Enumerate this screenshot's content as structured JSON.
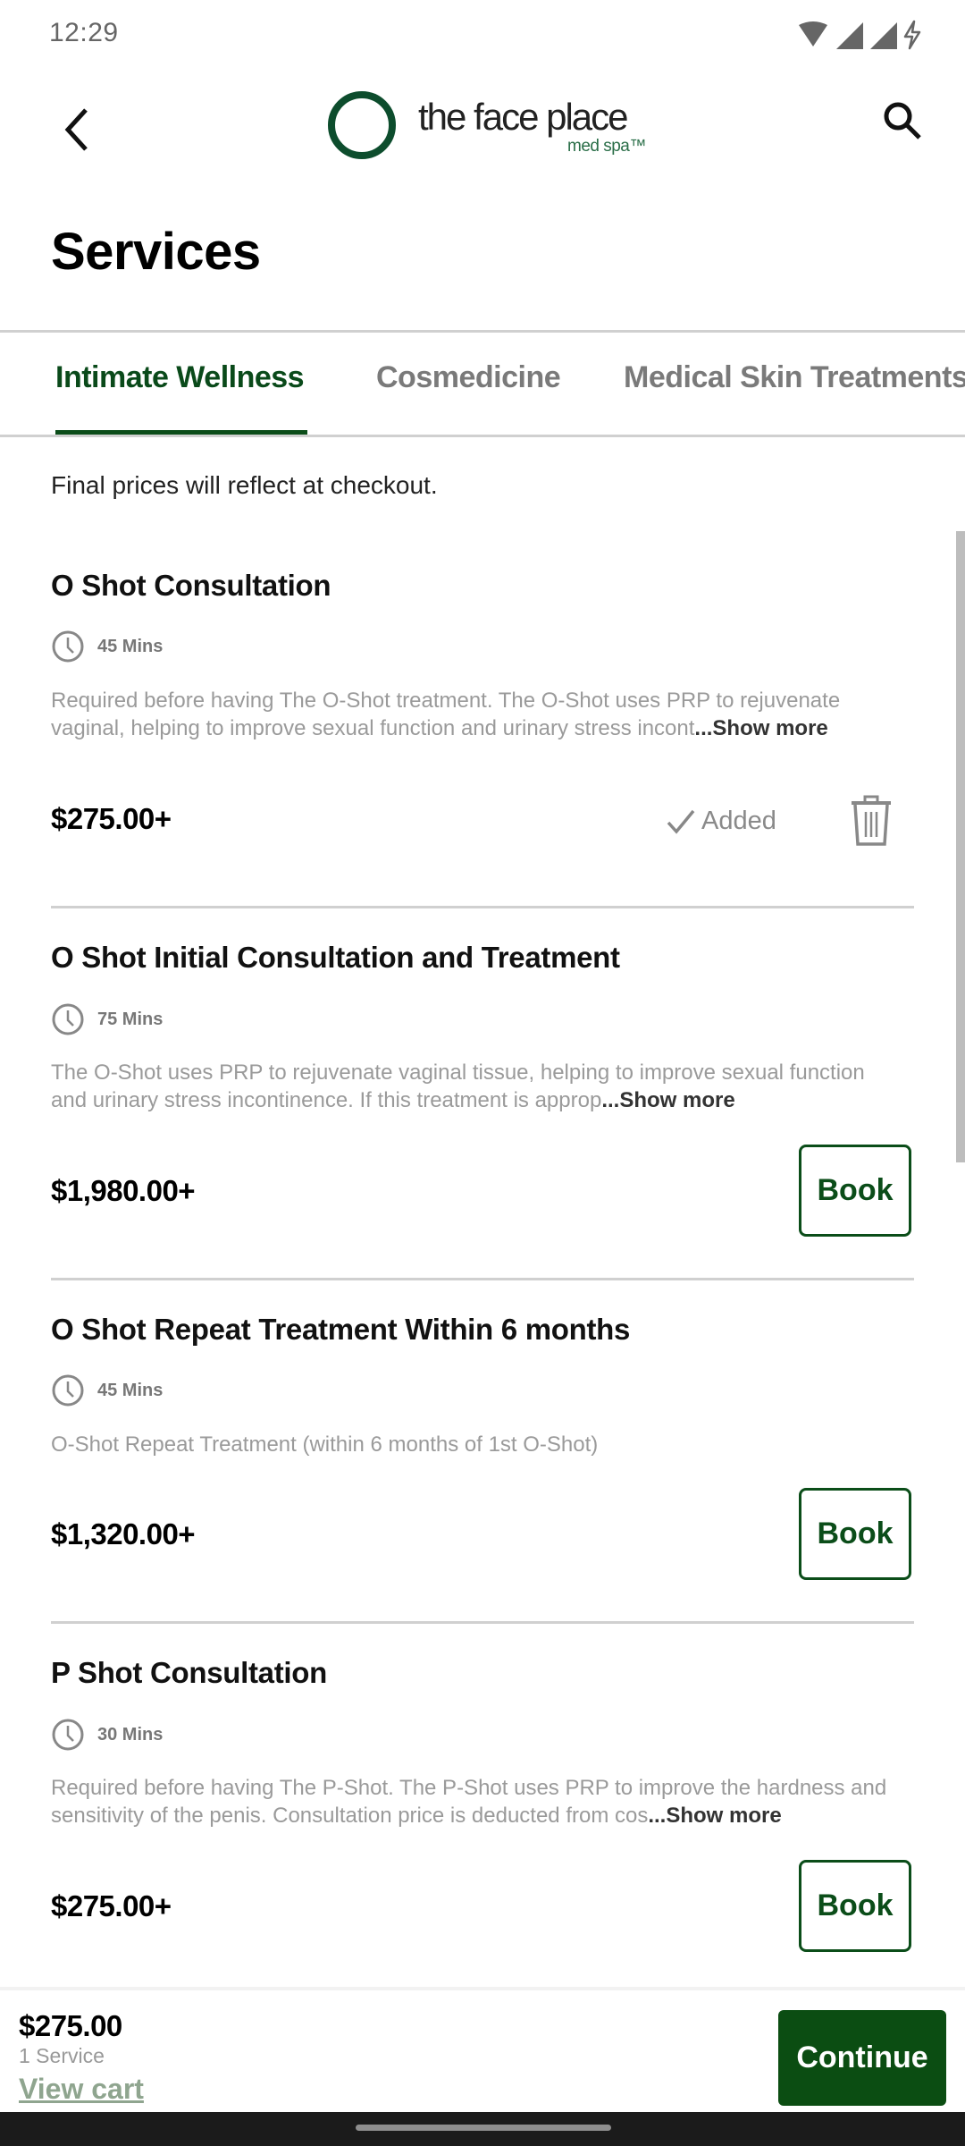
{
  "status_bar": {
    "time": "12:29",
    "icons": [
      "wifi-icon",
      "signal-icon",
      "signal-icon",
      "charging-icon"
    ]
  },
  "header": {
    "back_icon": "chevron-left-icon",
    "logo": {
      "name": "the face place",
      "tagline": "med spa™"
    },
    "search_icon": "search-icon"
  },
  "page_title": "Services",
  "tabs": [
    {
      "label": "Intimate Wellness",
      "active": true
    },
    {
      "label": "Cosmedicine",
      "active": false
    },
    {
      "label": "Medical Skin Treatments",
      "active": false
    }
  ],
  "notice": "Final prices will reflect at checkout.",
  "colors": {
    "brand_green": "#0b4d19",
    "muted_text": "#9a9a9a"
  },
  "services": [
    {
      "name": "O Shot Consultation",
      "duration": "45 Mins",
      "description": "Required before having The O-Shot treatment. The O-Shot uses PRP to rejuvenate vaginal, helping to improve sexual function and urinary stress incont",
      "show_more": "...Show more",
      "price": "$275.00+",
      "state": "added",
      "added_label": "Added"
    },
    {
      "name": "O Shot Initial Consultation and Treatment",
      "duration": "75 Mins",
      "description": "The O-Shot uses PRP to rejuvenate vaginal tissue, helping to improve sexual function and urinary stress incontinence. If this treatment is approp",
      "show_more": "...Show more",
      "price": "$1,980.00+",
      "book_label": "Book"
    },
    {
      "name": "O Shot Repeat Treatment Within 6 months",
      "duration": "45 Mins",
      "description": "O-Shot Repeat Treatment (within 6 months of 1st O-Shot)",
      "show_more": "",
      "price": "$1,320.00+",
      "book_label": "Book"
    },
    {
      "name": "P Shot Consultation",
      "duration": "30 Mins",
      "description": "Required before having The P-Shot. The P-Shot uses PRP to improve the hardness and sensitivity of the penis. Consultation price is deducted from cos",
      "show_more": "...Show more",
      "price": "$275.00+",
      "book_label": "Book"
    }
  ],
  "cart": {
    "total": "$275.00",
    "count": "1 Service",
    "view_cart": "View cart",
    "continue": "Continue"
  }
}
